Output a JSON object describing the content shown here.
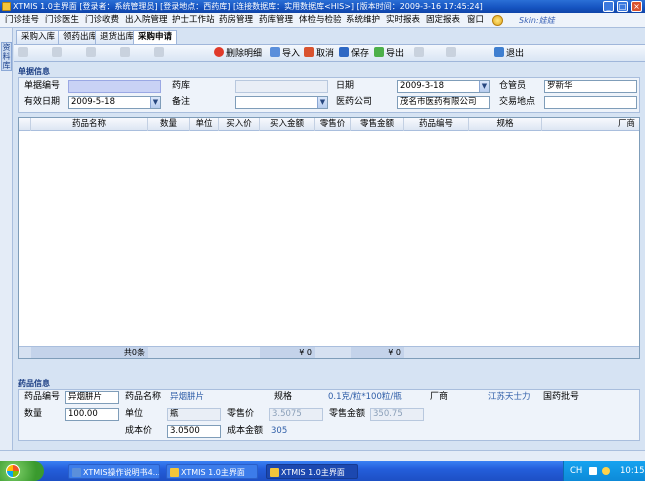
{
  "window": {
    "title": "XTMIS 1.0主界面   [登录者：系统管理员] [登录地点：西药库] [连接数据库：实用数据库<HIS>] [版本时间：2009-3-16 17:45:24]",
    "min": "_",
    "max": "□",
    "close": "×"
  },
  "menu": {
    "items": [
      "门诊挂号",
      "门诊医生",
      "门诊收费",
      "出入院管理",
      "护士工作站",
      "药房管理",
      "药库管理",
      "体检与检验",
      "系统维护",
      "实时报表",
      "固定报表",
      "窗口"
    ],
    "skin": "Skin:娃娃"
  },
  "left_strip": {
    "label": "资料库"
  },
  "doc_tabs": [
    "采购入库",
    "领药出库",
    "退货出库",
    "采购申请"
  ],
  "toolbar": {
    "disabled": [
      "",
      "",
      "",
      "",
      ""
    ],
    "delete_detail": "删除明细",
    "import": "导入",
    "cancel": "取消",
    "save": "保存",
    "export": "导出",
    "disabled_tail": [
      "",
      ""
    ],
    "exit": "退出"
  },
  "doc_info": {
    "group": "单据信息",
    "doc_no_label": "单据编号",
    "doc_no": "",
    "warehouse_label": "药库",
    "warehouse": "",
    "date_label": "日期",
    "date": "2009-3-18",
    "keeper_label": "仓管员",
    "keeper": "罗新华",
    "valid_label": "有效日期",
    "valid": "2009-5-18",
    "remark_label": "备注",
    "remark": "",
    "company_label": "医药公司",
    "company": "茂名市医药有限公司",
    "place_label": "交易地点",
    "place": ""
  },
  "grid": {
    "columns": [
      "药品名称",
      "数量",
      "单位",
      "买入价",
      "买入金额",
      "零售价",
      "零售金额",
      "药品编号",
      "规格",
      "厂商"
    ],
    "footer": {
      "count": "共0条",
      "buy_total": "¥ 0",
      "retail_total": "¥ 0"
    }
  },
  "drug_info": {
    "group": "药品信息",
    "code_label": "药品编号",
    "code": "异烟肼片",
    "name_label": "药品名称",
    "name": "异烟肼片",
    "spec_label": "规格",
    "spec": "0.1克/粒*100粒/瓶",
    "maker_label": "厂商",
    "maker": "江苏天士力",
    "approval_label": "国药批号",
    "qty_label": "数量",
    "qty": "100.00",
    "unit_label": "单位",
    "unit": "瓶",
    "retail_price_label": "零售价",
    "retail_price": "3.5075",
    "retail_amount_label": "零售金额",
    "retail_amount": "350.75",
    "cost_label": "成本价",
    "cost": "3.0500",
    "cost_amount_label": "成本金额",
    "cost_amount": "305"
  },
  "taskbar": {
    "tasks": [
      "XTMIS操作说明书4...",
      "XTMIS 1.0主界面",
      "XTMIS 1.0主界面"
    ],
    "lang": "CH",
    "time": "10:15"
  }
}
